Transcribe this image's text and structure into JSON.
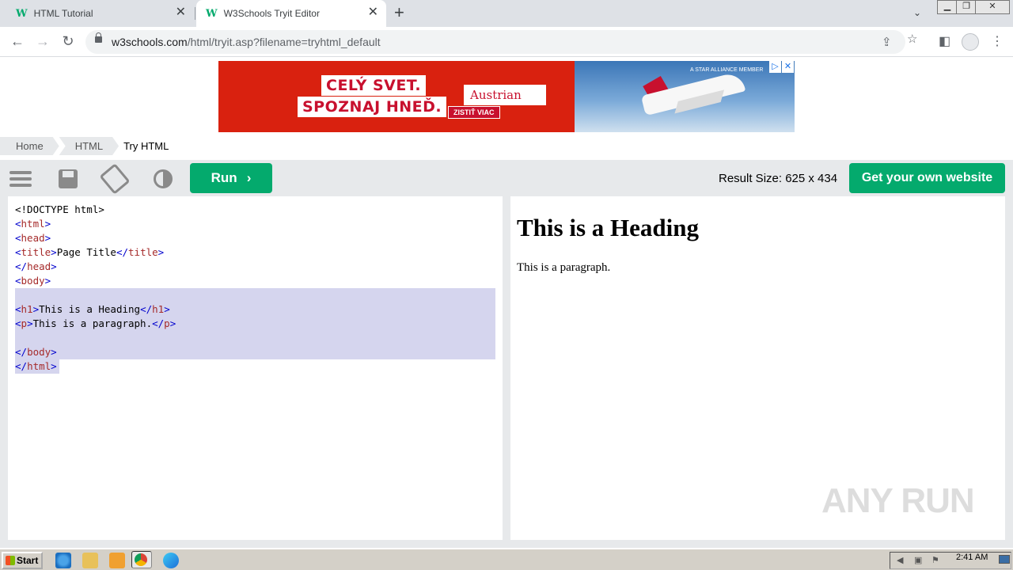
{
  "browser": {
    "tabs": [
      {
        "favicon": "W",
        "title": "HTML Tutorial",
        "close": "✕"
      },
      {
        "favicon": "W",
        "title": "W3Schools Tryit Editor",
        "close": "✕"
      }
    ],
    "new_tab": "+",
    "tab_menu": "⌄",
    "window_controls": {
      "minimize": "▁",
      "restore": "❐",
      "close": "✕"
    },
    "nav": {
      "back": "←",
      "forward": "→",
      "reload": "↻"
    },
    "url_host": "w3schools.com",
    "url_path": "/html/tryit.asp?filename=tryhtml_default",
    "icons": {
      "share": "share-icon",
      "star": "☆",
      "sidepanel": "◧",
      "menu": "⋮"
    }
  },
  "ad": {
    "headline1": "CELÝ SVET.",
    "headline2": "SPOZNAJ HNEĎ.",
    "cta": "ZISTIŤ VIAC",
    "brand": "Austrian",
    "alliance": "A STAR ALLIANCE MEMBER",
    "adchoices": "▷",
    "close": "✕",
    "colors": {
      "brand_red": "#d9210f"
    }
  },
  "breadcrumb": [
    "Home",
    "HTML",
    "Try HTML"
  ],
  "toolbar": {
    "run_label": "Run",
    "run_chevron": "›",
    "result_size": "Result Size: 625 x 434",
    "get_site_label": "Get your own website",
    "accent": "#04aa6d"
  },
  "editor": {
    "lines": [
      {
        "text": "<!DOCTYPE html>",
        "selected": false
      },
      {
        "text": "<html>",
        "selected": false
      },
      {
        "text": "<head>",
        "selected": false
      },
      {
        "text": "<title>Page Title</title>",
        "selected": false
      },
      {
        "text": "</head>",
        "selected": false
      },
      {
        "text": "<body>",
        "selected": false
      },
      {
        "text": "",
        "selected": true
      },
      {
        "text": "<h1>This is a Heading</h1>",
        "selected": true
      },
      {
        "text": "<p>This is a paragraph.</p>",
        "selected": true
      },
      {
        "text": "",
        "selected": true
      },
      {
        "text": "</body>",
        "selected": true
      },
      {
        "text": "</html>",
        "selected": true
      }
    ]
  },
  "result": {
    "heading": "This is a Heading",
    "paragraph": "This is a paragraph."
  },
  "watermark": "ANY RUN",
  "taskbar": {
    "start_label": "Start",
    "apps": [
      "ie-icon",
      "folder-icon",
      "media-icon",
      "chrome-icon",
      "edge-icon"
    ],
    "clock": "2:41 AM"
  }
}
